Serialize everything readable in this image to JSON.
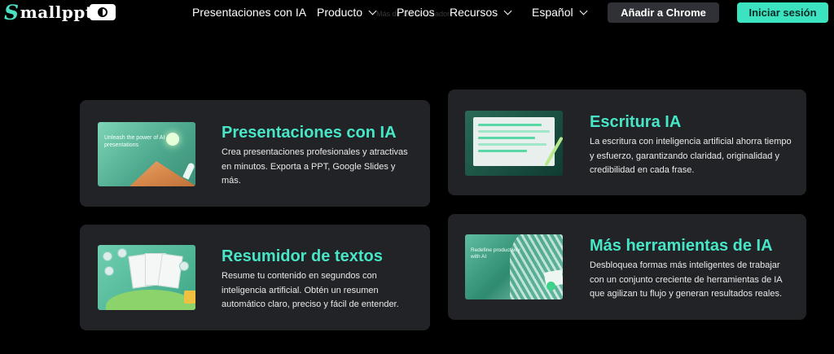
{
  "header": {
    "logo_initial": "S",
    "logo_rest": "mallppt",
    "nav": [
      {
        "label": "Presentaciones con IA",
        "dropdown": false
      },
      {
        "label": "Producto",
        "dropdown": true
      },
      {
        "label": "Precios",
        "dropdown": false
      },
      {
        "label": "Recursos",
        "dropdown": true
      },
      {
        "label": "Español",
        "dropdown": true
      }
    ],
    "ghost_text": "Más de 1M de creadores",
    "chrome_button": "Añadir a Chrome",
    "login_button": "Iniciar sesión"
  },
  "cards": [
    {
      "title": "Presentaciones con IA",
      "description": "Crea presentaciones profesionales y atractivas en minutos. Exporta a PPT, Google Slides y más.",
      "thumb_text": "Unleash the power of AI presentations"
    },
    {
      "title": "Escritura IA",
      "description": "La escritura con inteligencia artificial ahorra tiempo y esfuerzo, garantizando claridad, originalidad y credibilidad en cada frase."
    },
    {
      "title": "Resumidor de textos",
      "description": "Resume tu contenido en segundos con inteligencia artificial. Obtén un resumen automático claro, preciso y fácil de entender."
    },
    {
      "title": "Más herramientas de IA",
      "description": "Desbloquea formas más inteligentes de trabajar con un conjunto creciente de herramientas de IA que agilizan tu flujo y generan resultados reales.",
      "thumb_text": "Redefine productivity with AI"
    }
  ],
  "colors": {
    "accent": "#3be3c0",
    "title": "#46e6c6",
    "card_bg": "#222326",
    "page_bg": "#000000"
  },
  "icons": [
    "half-circle-theme-icon",
    "chevron-down-icon"
  ]
}
